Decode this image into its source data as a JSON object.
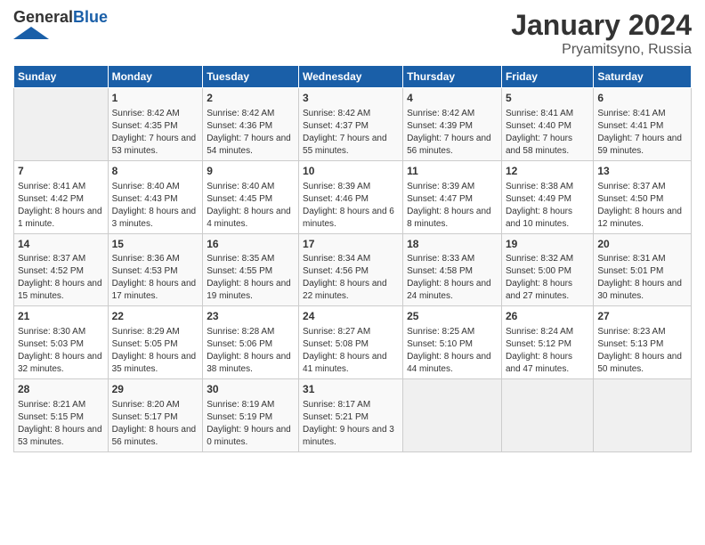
{
  "logo": {
    "general": "General",
    "blue": "Blue"
  },
  "title": {
    "month": "January 2024",
    "location": "Pryamitsyno, Russia"
  },
  "headers": [
    "Sunday",
    "Monday",
    "Tuesday",
    "Wednesday",
    "Thursday",
    "Friday",
    "Saturday"
  ],
  "weeks": [
    [
      {
        "day": "",
        "sunrise": "",
        "sunset": "",
        "daylight": ""
      },
      {
        "day": "1",
        "sunrise": "Sunrise: 8:42 AM",
        "sunset": "Sunset: 4:35 PM",
        "daylight": "Daylight: 7 hours and 53 minutes."
      },
      {
        "day": "2",
        "sunrise": "Sunrise: 8:42 AM",
        "sunset": "Sunset: 4:36 PM",
        "daylight": "Daylight: 7 hours and 54 minutes."
      },
      {
        "day": "3",
        "sunrise": "Sunrise: 8:42 AM",
        "sunset": "Sunset: 4:37 PM",
        "daylight": "Daylight: 7 hours and 55 minutes."
      },
      {
        "day": "4",
        "sunrise": "Sunrise: 8:42 AM",
        "sunset": "Sunset: 4:39 PM",
        "daylight": "Daylight: 7 hours and 56 minutes."
      },
      {
        "day": "5",
        "sunrise": "Sunrise: 8:41 AM",
        "sunset": "Sunset: 4:40 PM",
        "daylight": "Daylight: 7 hours and 58 minutes."
      },
      {
        "day": "6",
        "sunrise": "Sunrise: 8:41 AM",
        "sunset": "Sunset: 4:41 PM",
        "daylight": "Daylight: 7 hours and 59 minutes."
      }
    ],
    [
      {
        "day": "7",
        "sunrise": "Sunrise: 8:41 AM",
        "sunset": "Sunset: 4:42 PM",
        "daylight": "Daylight: 8 hours and 1 minute."
      },
      {
        "day": "8",
        "sunrise": "Sunrise: 8:40 AM",
        "sunset": "Sunset: 4:43 PM",
        "daylight": "Daylight: 8 hours and 3 minutes."
      },
      {
        "day": "9",
        "sunrise": "Sunrise: 8:40 AM",
        "sunset": "Sunset: 4:45 PM",
        "daylight": "Daylight: 8 hours and 4 minutes."
      },
      {
        "day": "10",
        "sunrise": "Sunrise: 8:39 AM",
        "sunset": "Sunset: 4:46 PM",
        "daylight": "Daylight: 8 hours and 6 minutes."
      },
      {
        "day": "11",
        "sunrise": "Sunrise: 8:39 AM",
        "sunset": "Sunset: 4:47 PM",
        "daylight": "Daylight: 8 hours and 8 minutes."
      },
      {
        "day": "12",
        "sunrise": "Sunrise: 8:38 AM",
        "sunset": "Sunset: 4:49 PM",
        "daylight": "Daylight: 8 hours and 10 minutes."
      },
      {
        "day": "13",
        "sunrise": "Sunrise: 8:37 AM",
        "sunset": "Sunset: 4:50 PM",
        "daylight": "Daylight: 8 hours and 12 minutes."
      }
    ],
    [
      {
        "day": "14",
        "sunrise": "Sunrise: 8:37 AM",
        "sunset": "Sunset: 4:52 PM",
        "daylight": "Daylight: 8 hours and 15 minutes."
      },
      {
        "day": "15",
        "sunrise": "Sunrise: 8:36 AM",
        "sunset": "Sunset: 4:53 PM",
        "daylight": "Daylight: 8 hours and 17 minutes."
      },
      {
        "day": "16",
        "sunrise": "Sunrise: 8:35 AM",
        "sunset": "Sunset: 4:55 PM",
        "daylight": "Daylight: 8 hours and 19 minutes."
      },
      {
        "day": "17",
        "sunrise": "Sunrise: 8:34 AM",
        "sunset": "Sunset: 4:56 PM",
        "daylight": "Daylight: 8 hours and 22 minutes."
      },
      {
        "day": "18",
        "sunrise": "Sunrise: 8:33 AM",
        "sunset": "Sunset: 4:58 PM",
        "daylight": "Daylight: 8 hours and 24 minutes."
      },
      {
        "day": "19",
        "sunrise": "Sunrise: 8:32 AM",
        "sunset": "Sunset: 5:00 PM",
        "daylight": "Daylight: 8 hours and 27 minutes."
      },
      {
        "day": "20",
        "sunrise": "Sunrise: 8:31 AM",
        "sunset": "Sunset: 5:01 PM",
        "daylight": "Daylight: 8 hours and 30 minutes."
      }
    ],
    [
      {
        "day": "21",
        "sunrise": "Sunrise: 8:30 AM",
        "sunset": "Sunset: 5:03 PM",
        "daylight": "Daylight: 8 hours and 32 minutes."
      },
      {
        "day": "22",
        "sunrise": "Sunrise: 8:29 AM",
        "sunset": "Sunset: 5:05 PM",
        "daylight": "Daylight: 8 hours and 35 minutes."
      },
      {
        "day": "23",
        "sunrise": "Sunrise: 8:28 AM",
        "sunset": "Sunset: 5:06 PM",
        "daylight": "Daylight: 8 hours and 38 minutes."
      },
      {
        "day": "24",
        "sunrise": "Sunrise: 8:27 AM",
        "sunset": "Sunset: 5:08 PM",
        "daylight": "Daylight: 8 hours and 41 minutes."
      },
      {
        "day": "25",
        "sunrise": "Sunrise: 8:25 AM",
        "sunset": "Sunset: 5:10 PM",
        "daylight": "Daylight: 8 hours and 44 minutes."
      },
      {
        "day": "26",
        "sunrise": "Sunrise: 8:24 AM",
        "sunset": "Sunset: 5:12 PM",
        "daylight": "Daylight: 8 hours and 47 minutes."
      },
      {
        "day": "27",
        "sunrise": "Sunrise: 8:23 AM",
        "sunset": "Sunset: 5:13 PM",
        "daylight": "Daylight: 8 hours and 50 minutes."
      }
    ],
    [
      {
        "day": "28",
        "sunrise": "Sunrise: 8:21 AM",
        "sunset": "Sunset: 5:15 PM",
        "daylight": "Daylight: 8 hours and 53 minutes."
      },
      {
        "day": "29",
        "sunrise": "Sunrise: 8:20 AM",
        "sunset": "Sunset: 5:17 PM",
        "daylight": "Daylight: 8 hours and 56 minutes."
      },
      {
        "day": "30",
        "sunrise": "Sunrise: 8:19 AM",
        "sunset": "Sunset: 5:19 PM",
        "daylight": "Daylight: 9 hours and 0 minutes."
      },
      {
        "day": "31",
        "sunrise": "Sunrise: 8:17 AM",
        "sunset": "Sunset: 5:21 PM",
        "daylight": "Daylight: 9 hours and 3 minutes."
      },
      {
        "day": "",
        "sunrise": "",
        "sunset": "",
        "daylight": ""
      },
      {
        "day": "",
        "sunrise": "",
        "sunset": "",
        "daylight": ""
      },
      {
        "day": "",
        "sunrise": "",
        "sunset": "",
        "daylight": ""
      }
    ]
  ]
}
